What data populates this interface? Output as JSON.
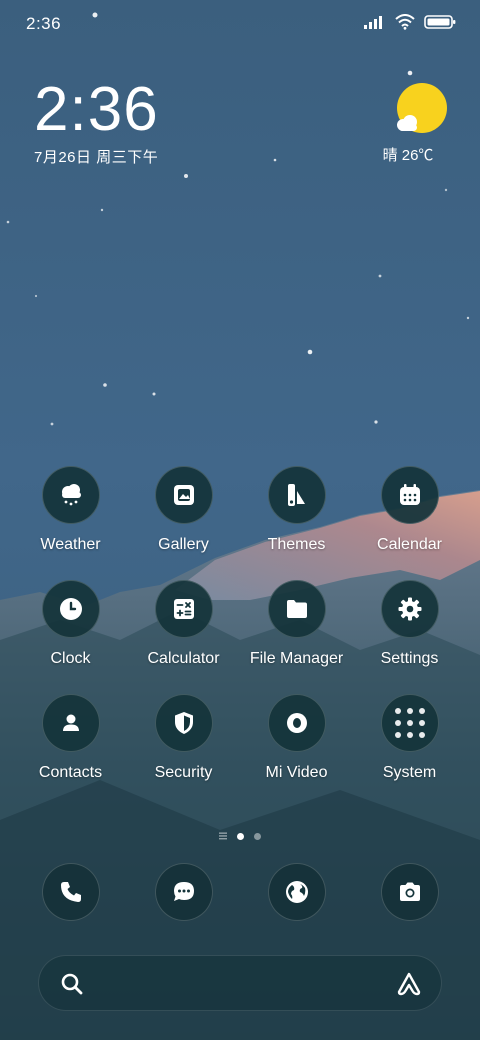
{
  "status_bar": {
    "time": "2:36",
    "icons": [
      "signal-icon",
      "wifi-icon",
      "battery-icon"
    ]
  },
  "clock_widget": {
    "time": "2:36",
    "date": "7月26日 周三下午"
  },
  "weather_widget": {
    "icon": "sun-cloud-icon",
    "text": "晴 26℃"
  },
  "apps": [
    {
      "label": "Weather",
      "icon": "cloud-rain-icon"
    },
    {
      "label": "Gallery",
      "icon": "image-icon"
    },
    {
      "label": "Themes",
      "icon": "palette-icon"
    },
    {
      "label": "Calendar",
      "icon": "calendar-icon"
    },
    {
      "label": "Clock",
      "icon": "clock-icon"
    },
    {
      "label": "Calculator",
      "icon": "calculator-icon"
    },
    {
      "label": "File Manager",
      "icon": "folder-icon"
    },
    {
      "label": "Settings",
      "icon": "gear-icon"
    },
    {
      "label": "Contacts",
      "icon": "person-icon"
    },
    {
      "label": "Security",
      "icon": "shield-icon"
    },
    {
      "label": "Mi Video",
      "icon": "video-icon"
    },
    {
      "label": "System",
      "icon": "folder-grid-icon"
    }
  ],
  "page_indicator": {
    "pages": 3,
    "active": 1
  },
  "dock": [
    {
      "icon": "phone-icon"
    },
    {
      "icon": "message-icon"
    },
    {
      "icon": "globe-icon"
    },
    {
      "icon": "camera-icon"
    }
  ],
  "colors": {
    "sky": "#3f6482",
    "sun": "#f8d21e",
    "icon_bg": "#14343a"
  }
}
